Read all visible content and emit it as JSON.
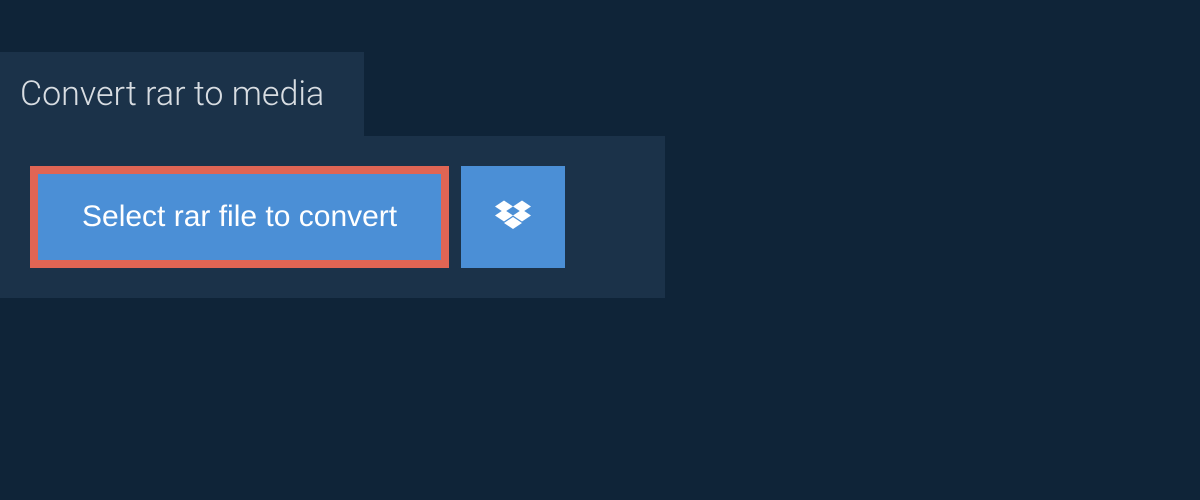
{
  "header": {
    "title": "Convert rar to media"
  },
  "actions": {
    "select_file_label": "Select rar file to convert",
    "dropbox_label": "Dropbox"
  },
  "colors": {
    "background": "#0f2438",
    "panel": "#1b3249",
    "button": "#4b8fd6",
    "highlight_border": "#e06554",
    "text_title": "#d8dde2",
    "text_button": "#ffffff"
  }
}
